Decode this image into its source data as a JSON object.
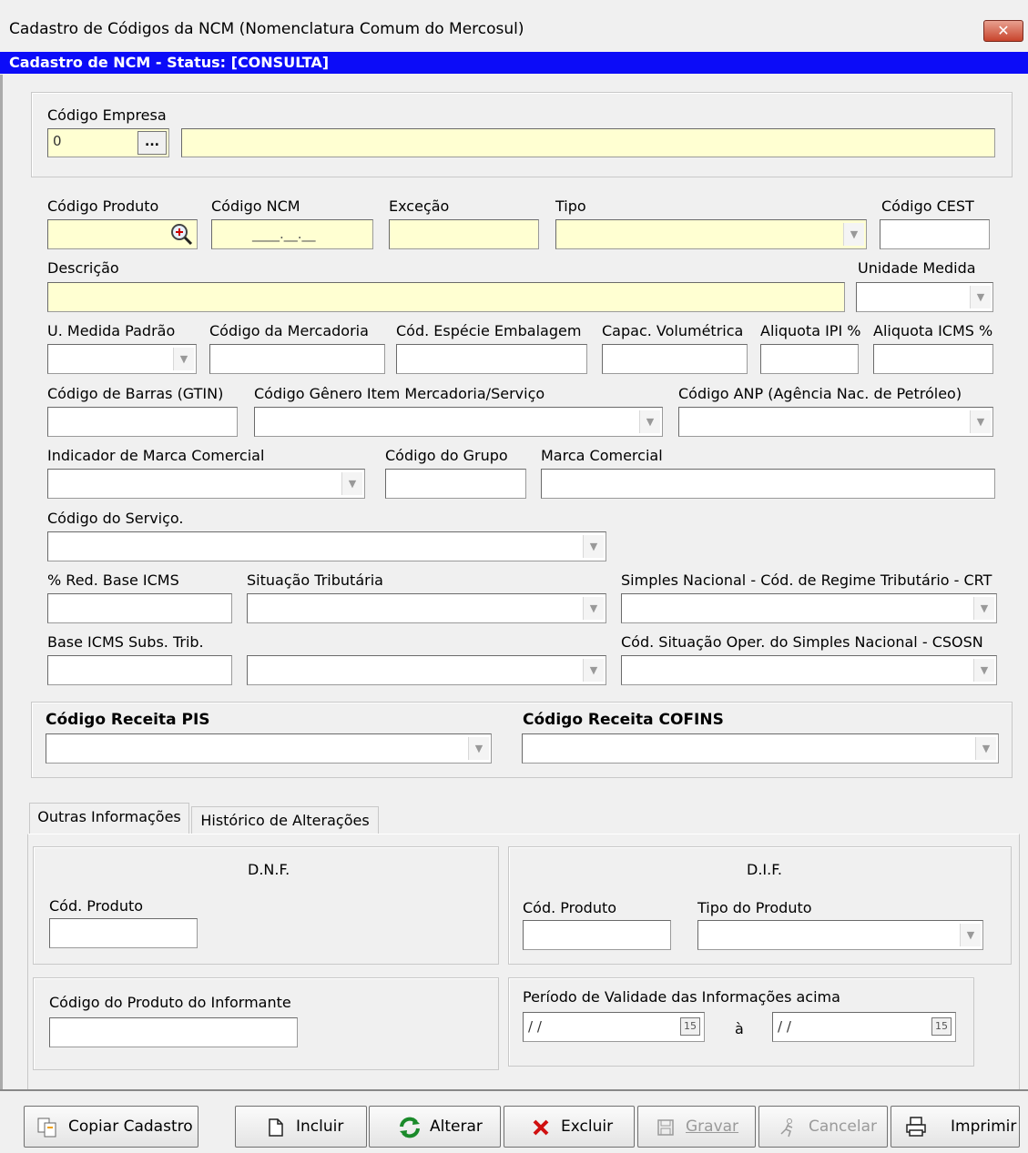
{
  "window": {
    "title": "Cadastro de Códigos da NCM (Nomenclatura Comum do Mercosul)",
    "close_label": "✕"
  },
  "status_bar": "Cadastro de NCM - Status: [CONSULTA]",
  "empresa": {
    "label": "Código  Empresa",
    "code_value": "0",
    "lookup_label": "..."
  },
  "fields": {
    "codigo_produto": "Código  Produto",
    "codigo_ncm": "Código  NCM",
    "codigo_ncm_mask": "____.__.__",
    "excecao": "Exceção",
    "tipo": "Tipo",
    "codigo_cest": "Código CEST",
    "descricao": "Descrição",
    "unidade_medida": "Unidade  Medida",
    "u_medida_padrao": "U. Medida Padrão",
    "codigo_mercadoria": "Código da Mercadoria",
    "cod_especie_embalagem": "Cód. Espécie Embalagem",
    "capac_volumetrica": "Capac. Volumétrica",
    "aliquota_ipi": "Aliquota IPI %",
    "aliquota_icms": "Aliquota ICMS %",
    "codigo_barras": "Código de Barras (GTIN)",
    "codigo_genero": "Código Gênero Item Mercadoria/Serviço",
    "codigo_anp": "Código ANP (Agência Nac. de Petróleo)",
    "indicador_marca": "Indicador de Marca Comercial",
    "codigo_grupo": "Código do Grupo",
    "marca_comercial": "Marca Comercial",
    "codigo_servico": "Código do Serviço.",
    "red_base_icms": "% Red. Base ICMS",
    "situacao_tributaria": "Situação Tributária",
    "simples_crt": "Simples Nacional - Cód. de Regime Tributário - CRT",
    "base_icms_st": "Base ICMS Subs. Trib.",
    "csosn": "Cód. Situação Oper. do Simples Nacional - CSOSN"
  },
  "receita": {
    "pis": "Código Receita PIS",
    "cofins": "Código Receita COFINS"
  },
  "tabs": [
    {
      "label": "Outras Informações"
    },
    {
      "label": "Histórico de Alterações"
    }
  ],
  "dnf": {
    "title": "D.N.F.",
    "cod_produto": "Cód. Produto"
  },
  "dif": {
    "title": "D.I.F.",
    "cod_produto": "Cód. Produto",
    "tipo_produto": "Tipo do Produto"
  },
  "informante": {
    "label": "Código do Produto do Informante"
  },
  "periodo": {
    "label": "Período de Validade das Informações acima",
    "date_from": " /  /",
    "date_to": " /  /",
    "separator": "à",
    "calendar_label": "15"
  },
  "buttons": {
    "copiar": "Copiar Cadastro",
    "incluir": "Incluir",
    "alterar": "Alterar",
    "excluir": "Excluir",
    "gravar": "Gravar",
    "cancelar": "Cancelar",
    "imprimir": "Imprimir"
  },
  "colors": {
    "status_bar": "#0c0cf8",
    "required_field": "#ffffd2"
  }
}
